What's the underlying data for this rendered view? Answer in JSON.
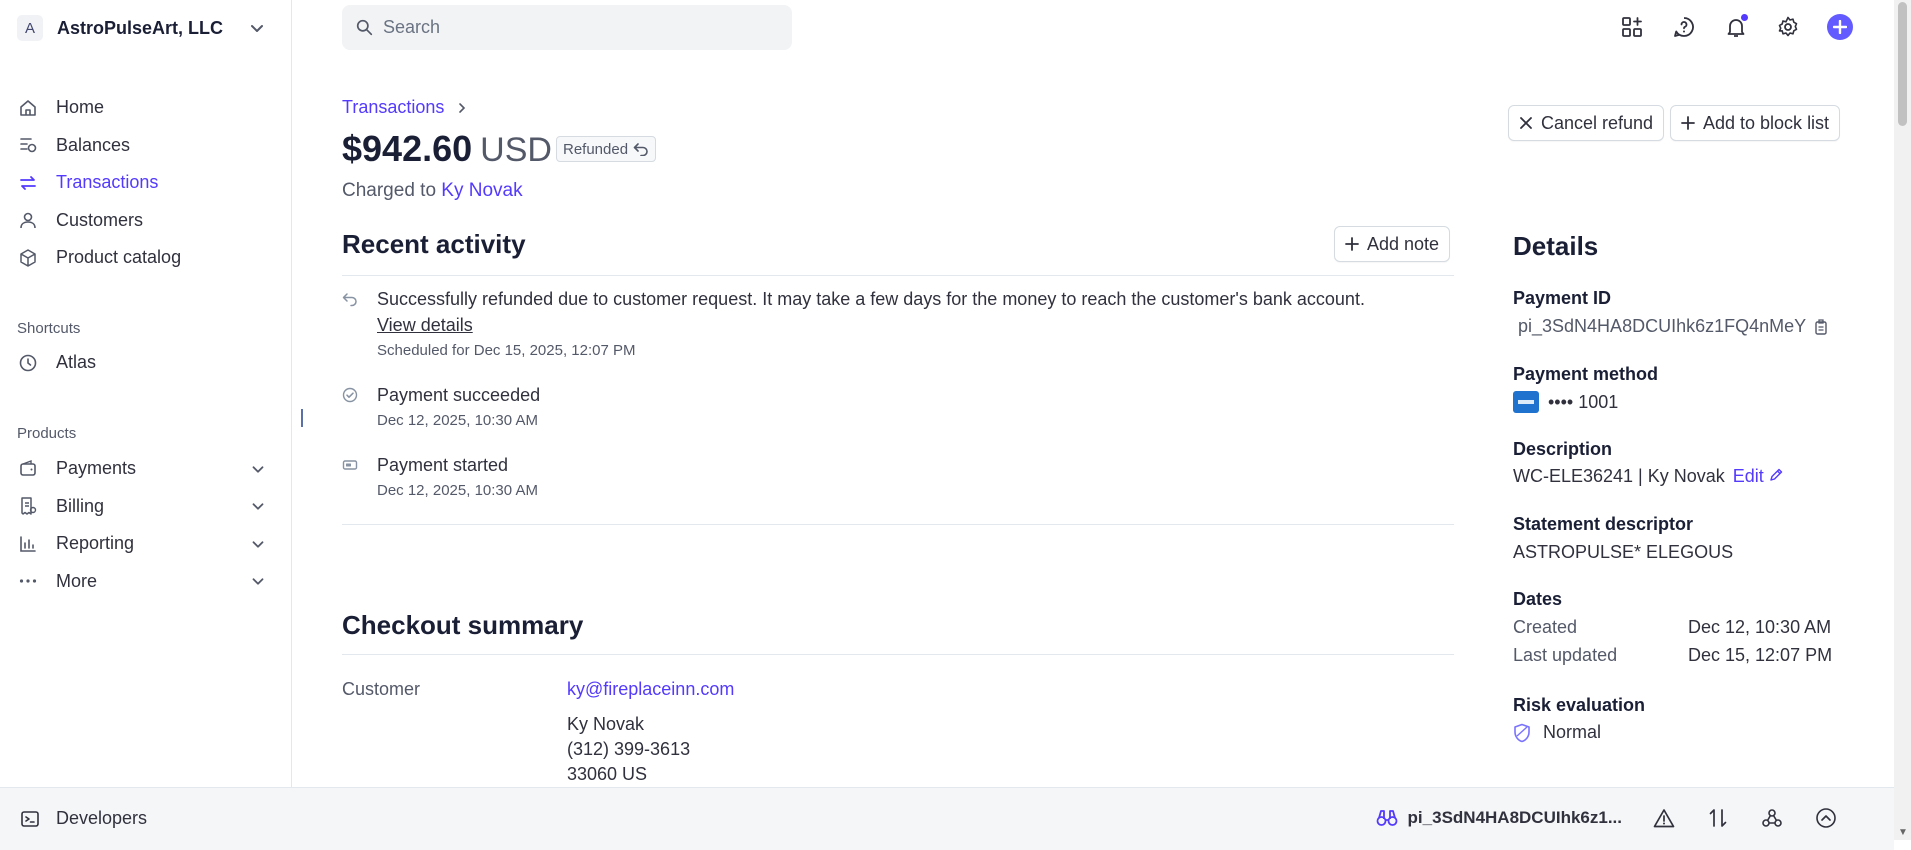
{
  "account": {
    "initial": "A",
    "name": "AstroPulseArt, LLC"
  },
  "nav": [
    {
      "label": "Home",
      "icon": "home-icon"
    },
    {
      "label": "Balances",
      "icon": "balances-icon"
    },
    {
      "label": "Transactions",
      "icon": "transactions-icon",
      "active": true
    },
    {
      "label": "Customers",
      "icon": "customer-icon"
    },
    {
      "label": "Product catalog",
      "icon": "box-icon"
    }
  ],
  "shortcuts": {
    "label": "Shortcuts",
    "items": [
      {
        "label": "Atlas",
        "icon": "clock-icon"
      }
    ]
  },
  "products": {
    "label": "Products",
    "items": [
      {
        "label": "Payments",
        "icon": "wallet-icon"
      },
      {
        "label": "Billing",
        "icon": "billing-icon"
      },
      {
        "label": "Reporting",
        "icon": "chart-icon"
      },
      {
        "label": "More",
        "icon": "more-icon"
      }
    ]
  },
  "search": {
    "placeholder": "Search"
  },
  "header": {
    "breadcrumb": "Transactions",
    "amount": "$942.60",
    "currency": "USD",
    "status": "Refunded",
    "charged_prefix": "Charged to",
    "customer_name": "Ky Novak",
    "cancel_refund": "Cancel refund",
    "add_block": "Add to block list"
  },
  "recent_activity": {
    "title": "Recent activity",
    "add_note": "Add note",
    "items": [
      {
        "text": "Successfully refunded due to customer request. It may take a few days for the money to reach the customer's bank account.",
        "link": "View details",
        "meta": "Scheduled for Dec 15, 2025, 12:07 PM"
      },
      {
        "text": "Payment succeeded",
        "meta": "Dec 12, 2025, 10:30 AM"
      },
      {
        "text": "Payment started",
        "meta": "Dec 12, 2025, 10:30 AM"
      }
    ]
  },
  "checkout": {
    "title": "Checkout summary",
    "customer_label": "Customer",
    "email": "ky@fireplaceinn.com",
    "name": "Ky Novak",
    "phone": "(312) 399-3613",
    "address": "33060 US"
  },
  "details": {
    "title": "Details",
    "payment_id_label": "Payment ID",
    "payment_id": "pi_3SdN4HA8DCUIhk6z1FQ4nMeY",
    "method_label": "Payment method",
    "method_value": "•••• 1001",
    "description_label": "Description",
    "description": "WC-ELE36241 | Ky Novak",
    "edit": "Edit",
    "statement_label": "Statement descriptor",
    "statement": "ASTROPULSE* ELEGOUS",
    "dates_label": "Dates",
    "created_label": "Created",
    "created": "Dec 12, 10:30 AM",
    "updated_label": "Last updated",
    "updated": "Dec 15, 12:07 PM",
    "risk_label": "Risk evaluation",
    "risk": "Normal"
  },
  "bottombar": {
    "developers": "Developers",
    "pi_short": "pi_3SdN4HA8DCUIhk6z1..."
  },
  "colors": {
    "accent": "#533afd",
    "brand": "#635bff",
    "text": "#30313d",
    "muted": "#545969",
    "border": "#e3e8ee"
  }
}
